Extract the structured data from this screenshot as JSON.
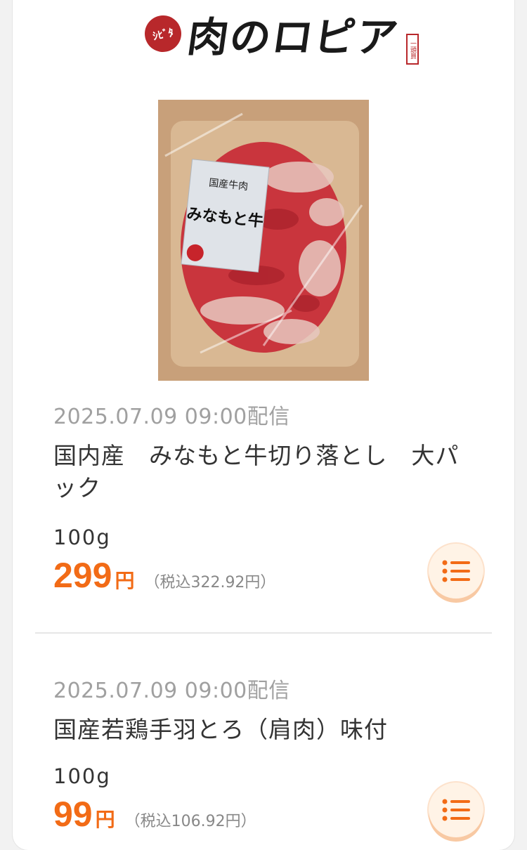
{
  "brand": {
    "badge_text": "ｼﾋﾞﾀ",
    "logo_text": "肉のロピア",
    "award_text": "一頭買"
  },
  "colors": {
    "accent": "#f26b16",
    "brand_red": "#b8282b"
  },
  "products": [
    {
      "date": "2025.07.09 09:00配信",
      "name": "国内産　みなもと牛切り落とし　大パック",
      "quantity": "100g",
      "price": "299",
      "yen": "円",
      "tax": "（税込322.92円）",
      "image_label": "みなもと牛",
      "image_caption": "国産牛肉",
      "list_icon": "list-icon"
    },
    {
      "date": "2025.07.09 09:00配信",
      "name": "国産若鶏手羽とろ（肩肉）味付",
      "quantity": "100g",
      "price": "99",
      "yen": "円",
      "tax": "（税込106.92円）",
      "list_icon": "list-icon"
    }
  ]
}
